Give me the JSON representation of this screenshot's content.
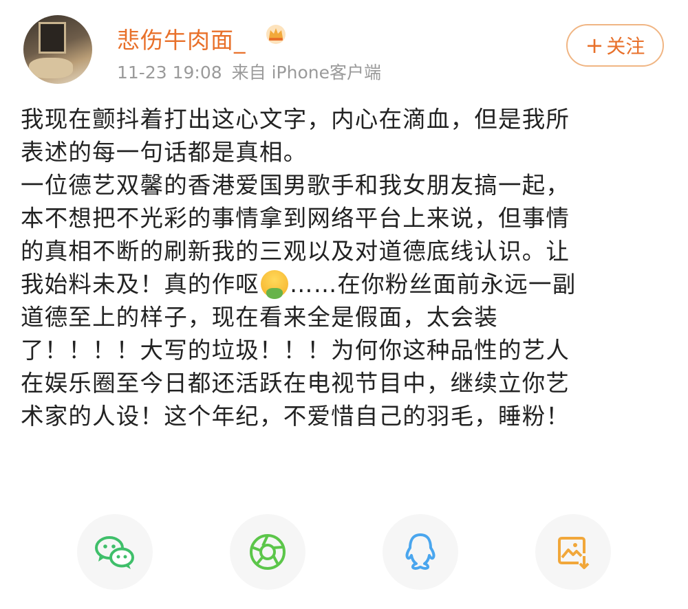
{
  "post": {
    "username": "悲伤牛肉面_",
    "timestamp": "11-23 19:08",
    "source": "来自 iPhone客户端",
    "follow_label": "关注",
    "follow_plus": "+",
    "content_lines_1": "我现在颤抖着打出这心文字，内心在滴血，但是我所\n表述的每一句话都是真相。\n一位德艺双馨的香港爱国男歌手和我女朋友搞一起，\n本不想把不光彩的事情拿到网络平台上来说，但事情\n的真相不断的刷新我的三观以及对道德底线认识。让\n我始料未及！真的作呕",
    "content_lines_2": "……在你粉丝面前永远一副\n道德至上的样子，现在看来全是假面，太会装\n了！！！！大写的垃圾！！！为何你这种品性的艺人\n在娱乐圈至今日都还活跃在电视节目中，继续立你艺\n术家的人设！这个年纪，不爱惜自己的羽毛，睡粉！"
  },
  "icons": {
    "vip": "crown-icon",
    "inline_emoji": "vomit-emoji-icon",
    "share": [
      "wechat-icon",
      "moments-icon",
      "qq-icon",
      "save-image-icon"
    ]
  },
  "colors": {
    "accent": "#e8702a",
    "meta_text": "#9a9a9a",
    "wechat": "#3fbf6a",
    "moments": "#5cc64a",
    "qq": "#4aa6ee",
    "save_image": "#f1a73a"
  }
}
